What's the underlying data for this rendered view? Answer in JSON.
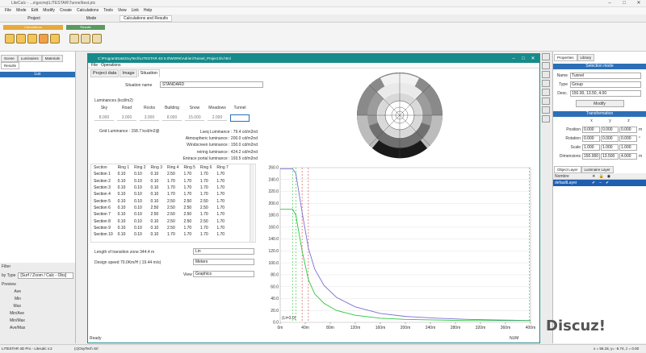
{
  "app": {
    "title": "LiteCalc - ...s\\gscmq\\LITESTAR\\Tunnel\\test.ptc",
    "menu": [
      "File",
      "Mode",
      "Edit",
      "Modify",
      "Create",
      "Calculations",
      "Tools",
      "View",
      "Link",
      "Help"
    ],
    "ribbon_tabs": [
      "Project",
      "Mode",
      "Calculations and Results"
    ],
    "ribbon_groups": [
      "Calculations",
      "Results"
    ]
  },
  "left_panel": {
    "tabs": [
      "Scene",
      "Luminaires",
      "Materials",
      "Results"
    ],
    "header": "Lux",
    "filter_label": "Filter",
    "by_type_label": "by Type",
    "by_type_value": "[Surf / Zoom / Calc - Obs]",
    "preview_label": "Preview",
    "preview_items": [
      "Ave",
      "Min",
      "Max",
      "Min/Ave",
      "Min/Max",
      "Ave/Max"
    ]
  },
  "window": {
    "title": "C:\\ProgramData\\OxyTech\\LITESTAR 4D 5.0\\WORK\\Adrien\\Tunnel_Project.tln.html",
    "menu": [
      "File",
      "Operations"
    ],
    "tabs": [
      "Project data",
      "Image",
      "Situation"
    ],
    "situation_label": "Situation name",
    "situation_value": "STANDARD",
    "luminances_label": "Luminances (kcd/m2)",
    "lum_headers": [
      "Sky",
      "Road",
      "Rocks",
      "Building",
      "Snow",
      "Meadows",
      "Tunnel"
    ],
    "lum_values": [
      "8.000",
      "3.000",
      "3.000",
      "8.000",
      "15.000",
      "2.000",
      ""
    ],
    "grid_luminance": "Grid Luminance : 158.7 kcd/m2@",
    "results": [
      "Lseq Luminance : 79.4 cd/m2nd",
      "Atmospheric luminance : 200.0 cd/m2nd",
      "Windscreen luminance : 150.0 cd/m2nd",
      "reiring luminance : 424.2 cd/m2nd",
      "Entrace portal luminance : 193.5 cd/m2nd"
    ],
    "table": {
      "headers": [
        "Section",
        "Ring 1",
        "Ring 2",
        "Ring 3",
        "Ring 4",
        "Ring 5",
        "Ring 6",
        "Ring 7"
      ],
      "rows": [
        [
          "Section 1",
          "0.10",
          "0.10",
          "0.10",
          "2.50",
          "1.70",
          "1.70",
          "1.70"
        ],
        [
          "Section 2",
          "0.10",
          "0.10",
          "0.10",
          "1.70",
          "1.70",
          "1.70",
          "1.70"
        ],
        [
          "Section 3",
          "0.10",
          "0.10",
          "0.10",
          "1.70",
          "1.70",
          "1.70",
          "1.70"
        ],
        [
          "Section 4",
          "0.10",
          "0.10",
          "0.10",
          "1.70",
          "1.70",
          "1.70",
          "1.70"
        ],
        [
          "Section 5",
          "0.10",
          "0.10",
          "0.10",
          "2.50",
          "2.50",
          "2.50",
          "1.70"
        ],
        [
          "Section 6",
          "0.10",
          "0.10",
          "2.50",
          "2.50",
          "2.50",
          "2.50",
          "1.70"
        ],
        [
          "Section 7",
          "0.10",
          "0.10",
          "2.50",
          "2.50",
          "2.50",
          "1.70",
          "1.70"
        ],
        [
          "Section 8",
          "0.10",
          "0.10",
          "0.10",
          "2.50",
          "2.50",
          "2.50",
          "1.70"
        ],
        [
          "Section 9",
          "0.10",
          "0.10",
          "0.10",
          "2.50",
          "1.70",
          "1.70",
          "1.70"
        ],
        [
          "Section 10",
          "0.10",
          "0.10",
          "0.10",
          "1.70",
          "1.70",
          "1.70",
          "1.70"
        ]
      ]
    },
    "transition_label": "Length of transition zone 344.4 m",
    "transition_select": "Lin",
    "speed_label": "Design speed 70.0Km/H ( 19.44 m/s)",
    "speed_select": "Meters",
    "view_label": "View",
    "view_select": "Graphics",
    "status": "Ready",
    "status_right": "NUM"
  },
  "chart_data": {
    "type": "line",
    "x_ticks": [
      "0m",
      "40m",
      "80m",
      "120m",
      "160m",
      "200m",
      "240m",
      "280m",
      "320m",
      "360m",
      "400m"
    ],
    "y_ticks": [
      "0.0",
      "20.0",
      "40.0",
      "60.0",
      "80.0",
      "100.0",
      "120.0",
      "140.0",
      "160.0",
      "180.0",
      "200.0",
      "220.0",
      "240.0",
      "260.0"
    ],
    "ylim": [
      0,
      260
    ],
    "xlim": [
      0,
      400
    ],
    "annotation": "(Lt=3.0)",
    "series": [
      {
        "color": "#7b6fd1",
        "x": [
          0,
          20,
          25,
          35,
          45,
          55,
          70,
          90,
          120,
          160,
          200,
          250,
          300,
          350,
          400
        ],
        "values": [
          258,
          258,
          250,
          185,
          125,
          90,
          62,
          42,
          26,
          15,
          10,
          7,
          5,
          4,
          3
        ]
      },
      {
        "color": "#29c93c",
        "x": [
          0,
          20,
          25,
          35,
          45,
          55,
          70,
          90,
          120,
          160,
          200,
          250,
          300,
          350,
          400
        ],
        "values": [
          190,
          190,
          180,
          120,
          72,
          48,
          32,
          20,
          12,
          7,
          5,
          4,
          3,
          3,
          3
        ]
      }
    ]
  },
  "right_panel": {
    "tabs": [
      "Properties",
      "Library"
    ],
    "selection_header": "Selection mode",
    "name_label": "Name",
    "name_value": "Tunnel",
    "type_label": "Type",
    "type_value": "Group",
    "desc_label": "Desc.",
    "desc_value": "150.00, 13.50, 4.00",
    "modify_button": "Modify",
    "transform_header": "Transformation",
    "axes": [
      "x",
      "y",
      "z"
    ],
    "position_label": "Position",
    "position": [
      "0.000",
      "0.000",
      "0.000"
    ],
    "position_unit": "m",
    "rotation_label": "Rotation",
    "rotation": [
      "0.000",
      "0.000",
      "0.000"
    ],
    "rotation_unit": "°",
    "scale_label": "Scale",
    "scale": [
      "1.000",
      "1.000",
      "1.000"
    ],
    "dimensions_label": "Dimensions",
    "dimensions": [
      "150.000",
      "13.500",
      "4.000"
    ],
    "dimensions_unit": "m",
    "layer_tabs": [
      "Object Layer",
      "Luminaire Layer"
    ],
    "layer_col": "Nombre",
    "layer_name": "defaultLayer"
  },
  "statusbar": {
    "left": "LITESTAR 4D Pro - Litecalc v.2",
    "mid": "(c)OxyTech Srl",
    "right": "x = 56.18, y= -5.74, z = 0.00"
  },
  "watermark": "Discuz!"
}
